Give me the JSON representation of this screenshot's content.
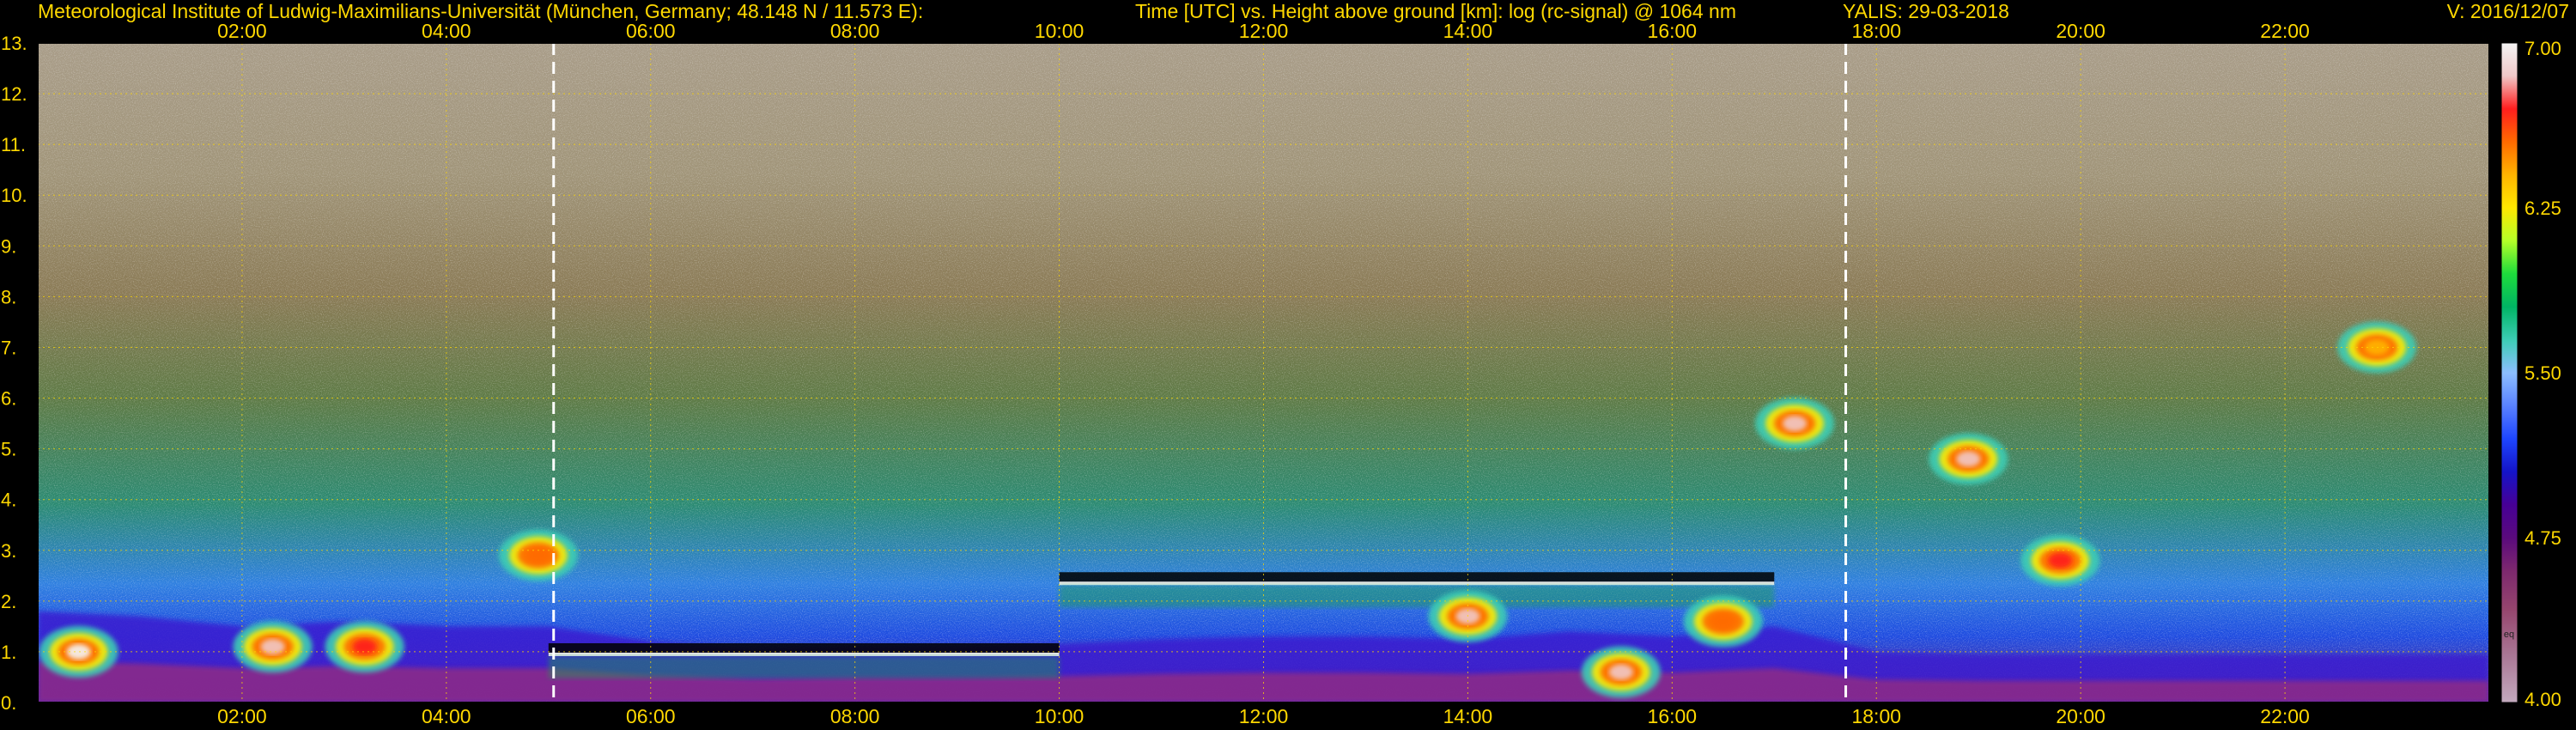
{
  "header": {
    "institute": "Meteorological Institute of Ludwig-Maximilians-Universität (München, Germany; 48.148 N / 11.573 E):",
    "axes_title": "Time [UTC] vs. Height above ground [km]: log (rc-signal) @ 1064 nm",
    "instrument_date": "YALIS: 29-03-2018",
    "version": "V: 2016/12/07"
  },
  "chart_data": {
    "type": "heatmap",
    "x_unit": "hours UTC",
    "xlim": [
      0,
      24
    ],
    "ylim": [
      0,
      13
    ],
    "x_ticks": [
      {
        "v": 2,
        "label": "02:00"
      },
      {
        "v": 4,
        "label": "04:00"
      },
      {
        "v": 6,
        "label": "06:00"
      },
      {
        "v": 8,
        "label": "08:00"
      },
      {
        "v": 10,
        "label": "10:00"
      },
      {
        "v": 12,
        "label": "12:00"
      },
      {
        "v": 14,
        "label": "14:00"
      },
      {
        "v": 16,
        "label": "16:00"
      },
      {
        "v": 18,
        "label": "18:00"
      },
      {
        "v": 20,
        "label": "20:00"
      },
      {
        "v": 22,
        "label": "22:00"
      }
    ],
    "y_ticks": [
      {
        "v": 0,
        "label": "0."
      },
      {
        "v": 1,
        "label": "1."
      },
      {
        "v": 2,
        "label": "2."
      },
      {
        "v": 3,
        "label": "3."
      },
      {
        "v": 4,
        "label": "4."
      },
      {
        "v": 5,
        "label": "5."
      },
      {
        "v": 6,
        "label": "6."
      },
      {
        "v": 7,
        "label": "7."
      },
      {
        "v": 8,
        "label": "8."
      },
      {
        "v": 9,
        "label": "9."
      },
      {
        "v": 10,
        "label": "10."
      },
      {
        "v": 11,
        "label": "11."
      },
      {
        "v": 12,
        "label": "12."
      },
      {
        "v": 13,
        "label": "13."
      }
    ],
    "grid": true,
    "sunrise_sunset_hours": [
      5.05,
      17.7
    ],
    "colorbar": {
      "range": [
        4.0,
        7.0
      ],
      "tick_labels": [
        {
          "v": 7.0,
          "label": "7.00"
        },
        {
          "v": 6.25,
          "label": "6.25"
        },
        {
          "v": 5.5,
          "label": "5.50"
        },
        {
          "v": 4.75,
          "label": "4.75"
        },
        {
          "v": 4.0,
          "label": "4.00"
        }
      ],
      "note": "eq",
      "colors_high_to_low": [
        "#f4f4f4",
        "#f0c8c8",
        "#ff1e1e",
        "#ff6a00",
        "#ffb400",
        "#ffe800",
        "#b4ff28",
        "#1edc3c",
        "#00b464",
        "#3ccdb4",
        "#8cbeff",
        "#5a82ff",
        "#1e46ff",
        "#1414c8",
        "#460096",
        "#5a0a7d",
        "#7d286e",
        "#96466e",
        "#aa7896",
        "#c3aabe"
      ]
    },
    "layers": [
      {
        "name": "boundary-layer",
        "top_km": [
          1.8,
          1.7,
          1.5,
          1.6,
          1.5,
          1.5,
          1.2,
          1.05,
          1.1,
          1.1,
          1.15,
          1.25,
          1.3,
          1.3,
          1.25,
          1.4,
          1.3,
          1.5,
          1.0,
          0.95,
          0.95,
          0.95,
          0.95,
          0.95,
          0.95
        ]
      },
      {
        "name": "aerosol-layer-top",
        "hours": [
          5.0,
          10.0
        ],
        "km": 1.05
      },
      {
        "name": "aerosol-layer-top",
        "hours": [
          10.0,
          17.0
        ],
        "km": 2.45
      }
    ],
    "clouds": [
      {
        "hour": 0.4,
        "km": 1.0,
        "intensity": 7.0
      },
      {
        "hour": 2.3,
        "km": 1.1,
        "intensity": 6.8
      },
      {
        "hour": 3.2,
        "km": 1.1,
        "intensity": 6.7
      },
      {
        "hour": 4.9,
        "km": 2.9,
        "intensity": 6.6
      },
      {
        "hour": 14.0,
        "km": 1.7,
        "intensity": 6.9
      },
      {
        "hour": 15.5,
        "km": 0.6,
        "intensity": 6.9
      },
      {
        "hour": 16.5,
        "km": 1.6,
        "intensity": 6.6
      },
      {
        "hour": 17.2,
        "km": 5.5,
        "intensity": 6.8
      },
      {
        "hour": 18.9,
        "km": 4.8,
        "intensity": 6.8
      },
      {
        "hour": 19.8,
        "km": 2.8,
        "intensity": 6.7
      },
      {
        "hour": 22.9,
        "km": 7.0,
        "intensity": 6.4
      }
    ]
  }
}
